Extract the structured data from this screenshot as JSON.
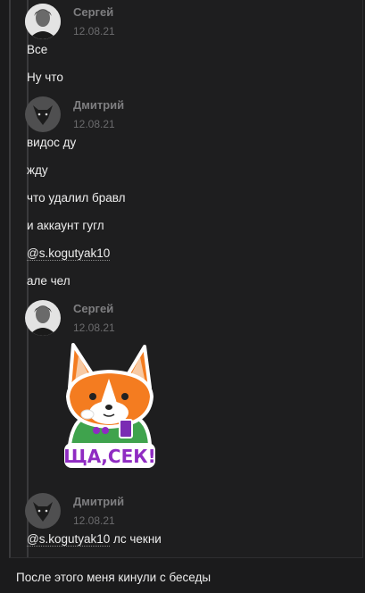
{
  "messages": [
    {
      "author": "Сергей",
      "date": "12.08.21",
      "avatar_icon": "user-photo-avatar",
      "lines": [
        "Все",
        "Ну что"
      ]
    },
    {
      "author": "Дмитрий",
      "date": "12.08.21",
      "avatar_icon": "dog-silhouette-avatar",
      "lines": [
        "видос ду",
        "жду",
        "что удалил бравл",
        "и аккаунт гугл"
      ],
      "mention_line": "@s.kogutyak10",
      "after_mention": "але чел"
    },
    {
      "author": "Сергей",
      "date": "12.08.21",
      "avatar_icon": "user-photo-avatar",
      "sticker": {
        "icon": "corgi-sticker",
        "caption": "ЩА,СЕК!"
      }
    },
    {
      "author": "Дмитрий",
      "date": "12.08.21",
      "avatar_icon": "dog-silhouette-avatar",
      "mention": "@s.kogutyak10",
      "text": " лс чекни"
    }
  ],
  "footer_note": "После этого меня кинули с беседы",
  "colors": {
    "background": "#1b1b1c",
    "name": "#7e7e80",
    "text": "#eeeeee"
  }
}
